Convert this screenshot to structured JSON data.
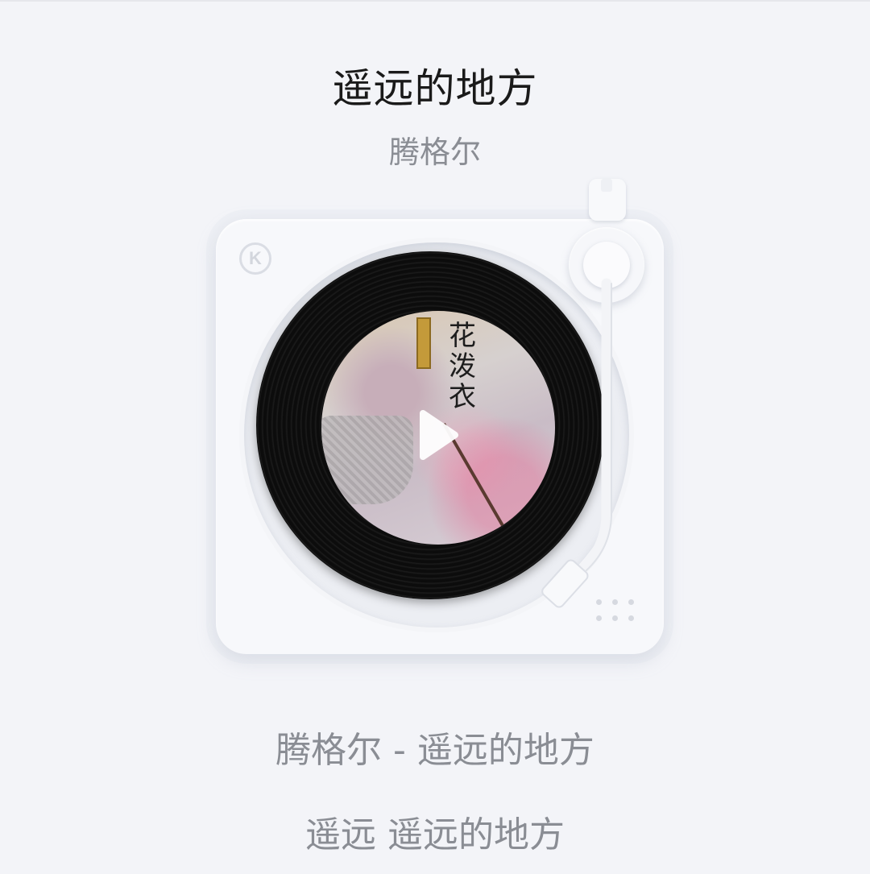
{
  "song": {
    "title": "遥远的地方",
    "artist": "腾格尔"
  },
  "player": {
    "logo_text": "K",
    "cover_text": "花泼衣",
    "play_icon": "play-icon"
  },
  "bottom": {
    "track_line": "腾格尔 - 遥远的地方",
    "lyric_line": "遥远 遥远的地方"
  },
  "colors": {
    "background": "#f3f4f8",
    "title": "#1a1a1a",
    "secondary_text": "#8a8d94",
    "record": "#0c0c0c"
  }
}
